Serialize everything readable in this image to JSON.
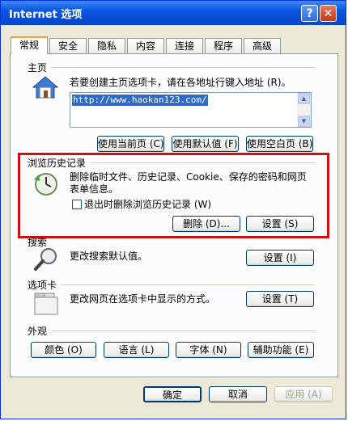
{
  "window": {
    "title": "Internet 选项",
    "help": "?",
    "close": "✕"
  },
  "tabs": [
    "常规",
    "安全",
    "隐私",
    "内容",
    "连接",
    "程序",
    "高级"
  ],
  "home": {
    "header": "主页",
    "desc": "若要创建主页选项卡，请在各地址行键入地址 (R)。",
    "url": "http://www.haokan123.com/",
    "btn_current": "使用当前页 (C)",
    "btn_default": "使用默认值 (F)",
    "btn_blank": "使用空白页 (B)"
  },
  "history": {
    "header": "浏览历史记录",
    "desc1": "删除临时文件、历史记录、Cookie、保存的密码和网页",
    "desc2": "表单信息。",
    "checkbox_label": "退出时删除浏览历史记录 (W)",
    "checkbox_checked": false,
    "btn_delete": "删除 (D)...",
    "btn_settings": "设置 (S)"
  },
  "search": {
    "header": "搜索",
    "desc": "更改搜索默认值。",
    "btn_settings": "设置 (I)"
  },
  "tabsgroup": {
    "header": "选项卡",
    "desc": "更改网页在选项卡中显示的方式。",
    "btn_settings": "设置 (T)"
  },
  "appearance": {
    "header": "外观",
    "btn_colors": "颜色 (O)",
    "btn_languages": "语言 (L)",
    "btn_fonts": "字体 (N)",
    "btn_accessibility": "辅助功能 (E)"
  },
  "footer": {
    "ok": "确定",
    "cancel": "取消",
    "apply": "应用 (A)"
  },
  "colors": {
    "titlebar": "#0a56e2",
    "highlight": "#d01010",
    "selection": "#316ac5"
  }
}
